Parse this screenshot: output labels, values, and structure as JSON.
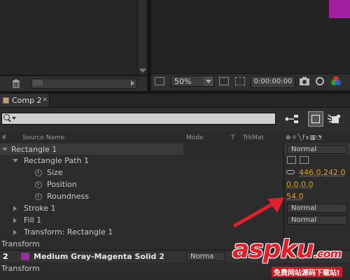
{
  "project_panel": {},
  "comp_viewer": {
    "zoom": "50%",
    "timecode": "0:00:00:00",
    "swatch_color": "#a020a0"
  },
  "timeline": {
    "tab_label": "Comp 2",
    "tab_close": "×",
    "columns": {
      "hash": "#",
      "source_name": "Source Name",
      "mode": "Mode",
      "t": "T",
      "trkmat": "TrkMat"
    },
    "rows": {
      "rectangle1": {
        "label": "Rectangle 1",
        "mode": "Normal"
      },
      "rect_path": {
        "label": "Rectangle Path 1"
      },
      "size": {
        "label": "Size",
        "value": "446.0,242.0"
      },
      "position": {
        "label": "Position",
        "value": "0.0,0.0"
      },
      "roundness": {
        "label": "Roundness",
        "value": "54.0"
      },
      "stroke": {
        "label": "Stroke 1",
        "mode": "Normal"
      },
      "fill": {
        "label": "Fill 1",
        "mode": "Normal"
      },
      "transform_rect": {
        "label": "Transform: Rectangle 1"
      },
      "transform": {
        "label": "Transform"
      },
      "layer2": {
        "number": "2",
        "name": "Medium Gray-Magenta Solid 2",
        "mode": "Norma",
        "color": "#a02aa8"
      },
      "transform2": {
        "label": "Transform"
      }
    }
  },
  "watermark": {
    "brand": "aspku",
    "brand_suffix": ".com",
    "tagline": "免费网站源码下载站!"
  },
  "colors": {
    "accent_value": "#e2a11b",
    "annotation_arrow": "#e0202a"
  }
}
